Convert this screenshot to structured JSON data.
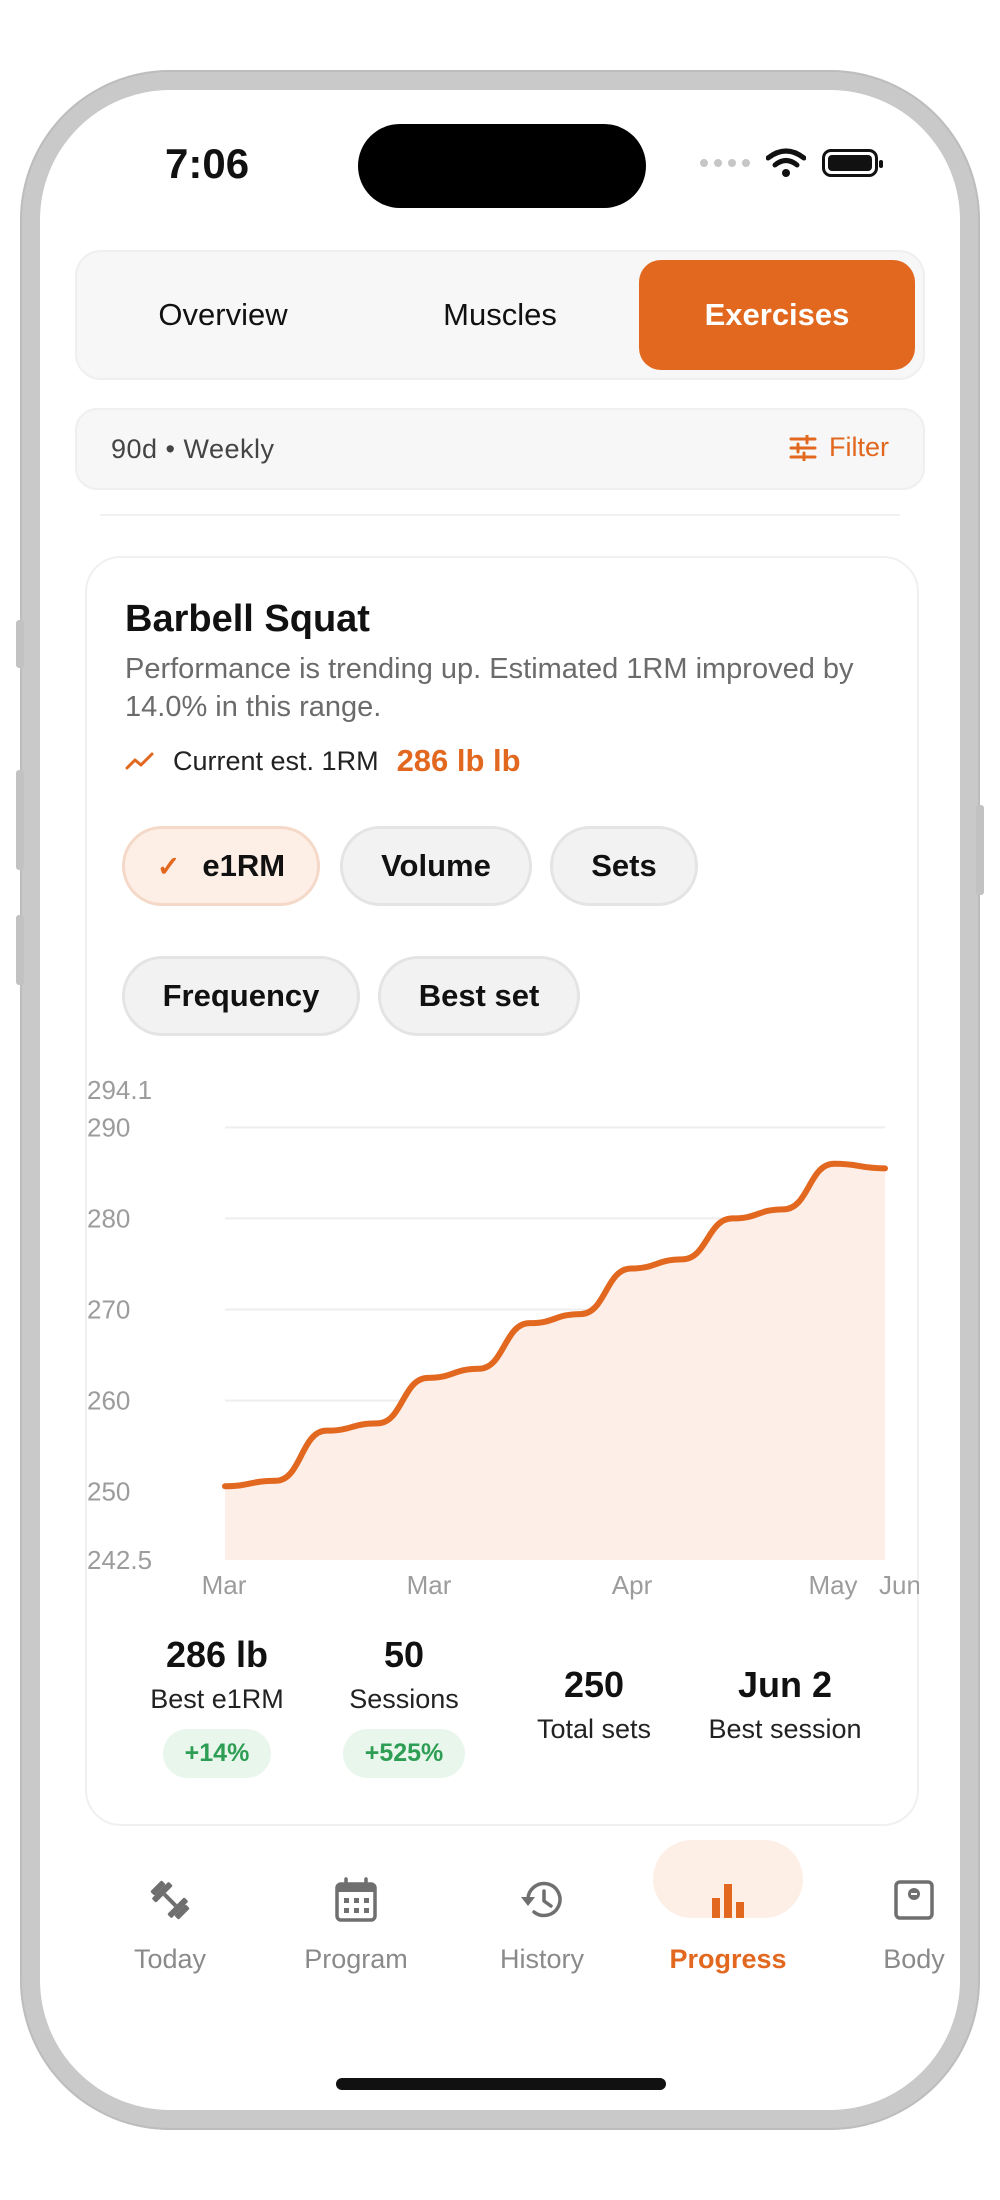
{
  "status": {
    "time": "7:06"
  },
  "segments": [
    {
      "label": "Overview",
      "active": false
    },
    {
      "label": "Muscles",
      "active": false
    },
    {
      "label": "Exercises",
      "active": true
    }
  ],
  "filter": {
    "range": "90d • Weekly",
    "button": "Filter"
  },
  "exercise": {
    "title": "Barbell Squat",
    "description": "Performance is trending up. Estimated 1RM improved by 14.0% in this range.",
    "current_label": "Current est. 1RM",
    "current_value": "286 lb lb"
  },
  "metric_chips": [
    {
      "label": "e1RM",
      "selected": true
    },
    {
      "label": "Volume",
      "selected": false
    },
    {
      "label": "Sets",
      "selected": false
    },
    {
      "label": "Frequency",
      "selected": false
    },
    {
      "label": "Best set",
      "selected": false
    }
  ],
  "chart_data": {
    "type": "area",
    "metric": "e1RM",
    "y_ticks": [
      "294.1",
      "290",
      "280",
      "270",
      "260",
      "250",
      "242.5"
    ],
    "ylim": [
      242.5,
      294.1
    ],
    "x_tick_labels": [
      "Mar",
      "Mar",
      "Apr",
      "May",
      "Jun"
    ],
    "x": [
      0,
      1,
      2,
      3,
      4,
      5,
      6,
      7,
      8,
      9,
      10,
      11,
      12,
      13
    ],
    "values": [
      250.6,
      251.2,
      256.7,
      257.5,
      262.5,
      263.5,
      268.5,
      269.5,
      274.5,
      275.5,
      280.0,
      281.0,
      286.0,
      285.5
    ],
    "grid": true,
    "line_color": "#e2681f",
    "fill_color": "#fdeee8"
  },
  "stats": [
    {
      "value": "286 lb",
      "label": "Best e1RM",
      "badge": "+14%"
    },
    {
      "value": "50",
      "label": "Sessions",
      "badge": "+525%"
    },
    {
      "value": "250",
      "label": "Total sets",
      "badge": null
    },
    {
      "value": "Jun 2",
      "label": "Best session",
      "badge": null
    }
  ],
  "tabs": [
    {
      "label": "Today",
      "icon": "dumbbell-icon",
      "active": false
    },
    {
      "label": "Program",
      "icon": "calendar-icon",
      "active": false
    },
    {
      "label": "History",
      "icon": "history-icon",
      "active": false
    },
    {
      "label": "Progress",
      "icon": "bar-chart-icon",
      "active": true
    },
    {
      "label": "Body",
      "icon": "scale-icon",
      "active": false
    }
  ],
  "colors": {
    "accent": "#e2681f",
    "positive": "#2f9e55"
  }
}
